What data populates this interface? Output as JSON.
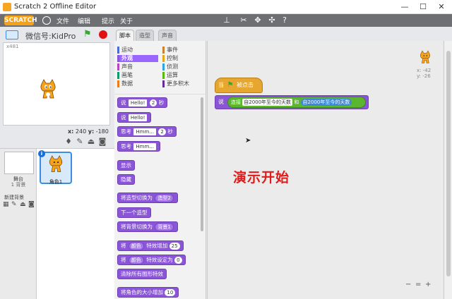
{
  "window": {
    "title": "Scratch 2 Offline Editor",
    "minimize": "—",
    "restore": "☐",
    "close": "✕"
  },
  "menubar": {
    "logo": "SCRATCH",
    "items": [
      "文件",
      "编辑",
      "提示",
      "关于"
    ],
    "tools": [
      "duplicate",
      "delete",
      "grow",
      "shrink",
      "help"
    ]
  },
  "stage": {
    "project_name": "微信号:KidProg",
    "coord_label": "x481",
    "mouse_x_label": "x:",
    "mouse_x": "240",
    "mouse_y_label": "y:",
    "mouse_y": "-180"
  },
  "sprites": {
    "stage_label": "舞台",
    "stage_sub": "1 背景",
    "new_backdrop": "新建背景",
    "sprite_name": "角色1",
    "info": "i"
  },
  "tabs": [
    "脚本",
    "造型",
    "声音"
  ],
  "categories": [
    {
      "label": "运动",
      "color": "#4a6cd4"
    },
    {
      "label": "事件",
      "color": "#c88330"
    },
    {
      "label": "外观",
      "color": "#8a55d7",
      "selected": true
    },
    {
      "label": "控制",
      "color": "#e1a91a"
    },
    {
      "label": "声音",
      "color": "#bb42c3"
    },
    {
      "label": "侦测",
      "color": "#2ca5e2"
    },
    {
      "label": "画笔",
      "color": "#0e9a6c"
    },
    {
      "label": "运算",
      "color": "#5cb712"
    },
    {
      "label": "数据",
      "color": "#ee7d16"
    },
    {
      "label": "更多积木",
      "color": "#632d99"
    }
  ],
  "palette_blocks": {
    "say_secs": {
      "text": "说",
      "arg": "Hello!",
      "num": "2",
      "unit": "秒"
    },
    "say": {
      "text": "说",
      "arg": "Hello!"
    },
    "think_secs": {
      "text": "思考",
      "arg": "Hmm...",
      "num": "2",
      "unit": "秒"
    },
    "think": {
      "text": "思考",
      "arg": "Hmm..."
    },
    "show": "显示",
    "hide": "隐藏",
    "switch_costume": {
      "text": "将造型切换为",
      "arg": "造型2"
    },
    "next_costume": "下一个造型",
    "switch_backdrop": {
      "text": "将背景切换为",
      "arg": "背景1"
    },
    "change_effect": {
      "text": "将",
      "arg": "颜色",
      "mid": "特效增加",
      "num": "25"
    },
    "set_effect": {
      "text": "将",
      "arg": "颜色",
      "mid": "特效设定为",
      "num": "0"
    },
    "clear_effects": "清除所有图形特效",
    "change_size": {
      "text": "将角色的大小增加",
      "num": "10"
    }
  },
  "script": {
    "hat_when": "当",
    "hat_clicked": "被点击",
    "say": "说",
    "join_label": "连接",
    "join_arg1": "自2000年至今的天数",
    "join_and": "和",
    "join_arg2": "自2000年至今的天数"
  },
  "overlay_text": "演示开始",
  "sprite_info": {
    "x": "x: -42",
    "y": "y: -26"
  },
  "zoom": {
    "out": "−",
    "reset": "=",
    "in": "+"
  }
}
